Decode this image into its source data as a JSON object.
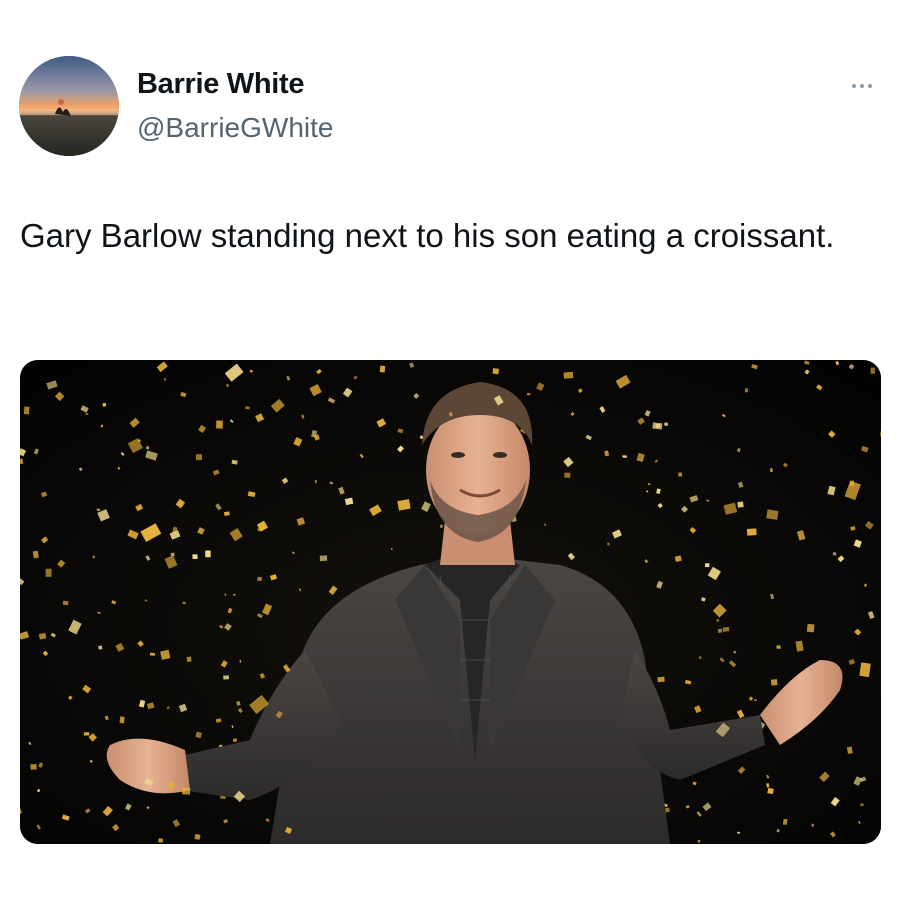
{
  "author": {
    "display_name": "Barrie White",
    "handle": "@BarrieGWhite",
    "avatar_icon": "avatar-sunset-photo"
  },
  "tweet": {
    "text": "Gary Barlow standing next to his son eating a croissant."
  },
  "media": {
    "subject": "man-in-suit-with-gold-confetti-photo"
  },
  "actions": {
    "more_icon": "more-horizontal-icon"
  },
  "colors": {
    "text": "#0f1419",
    "secondary_text": "#536471",
    "confetti_gold": "#e8b23a",
    "photo_background": "#050505"
  }
}
